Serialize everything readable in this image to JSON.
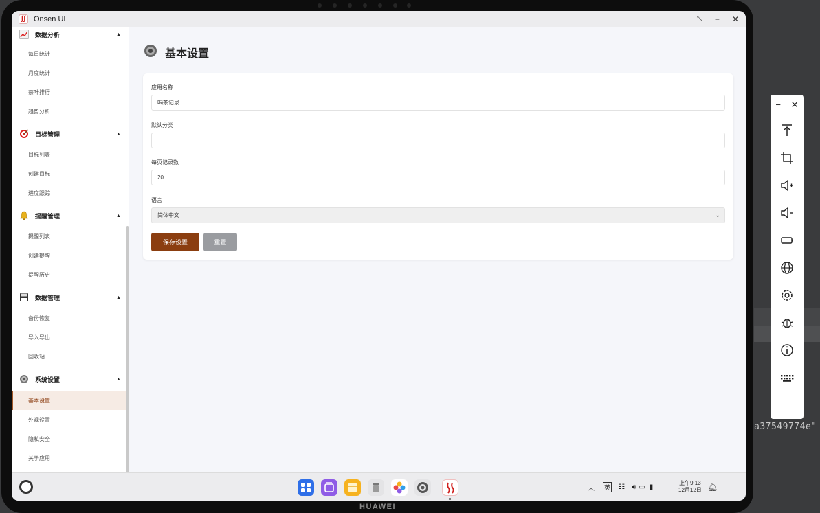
{
  "window": {
    "title": "Onsen UI",
    "logo_glyph": "ʃʃ"
  },
  "backdrop": {
    "text": "a37549774e\""
  },
  "device": {
    "brand": "HUAWEI"
  },
  "sidebar": {
    "groups": [
      {
        "label": "数据分析",
        "icon": "chart-icon",
        "items": [
          "每日统计",
          "月度统计",
          "茶叶排行",
          "趋势分析"
        ]
      },
      {
        "label": "目标管理",
        "icon": "target-icon",
        "items": [
          "目标列表",
          "创建目标",
          "进度跟踪"
        ]
      },
      {
        "label": "提醒管理",
        "icon": "bell-icon",
        "items": [
          "提醒列表",
          "创建提醒",
          "提醒历史"
        ]
      },
      {
        "label": "数据管理",
        "icon": "floppy-icon",
        "items": [
          "备份恢复",
          "导入导出",
          "回收站"
        ]
      },
      {
        "label": "系统设置",
        "icon": "gear-icon",
        "items": [
          "基本设置",
          "外观设置",
          "隐私安全",
          "关于应用"
        ]
      }
    ],
    "active_item": "基本设置"
  },
  "main": {
    "page_title": "基本设置",
    "form": {
      "app_name_label": "应用名称",
      "app_name_value": "喝茶记录",
      "default_category_label": "默认分类",
      "default_category_value": "",
      "per_page_label": "每页记录数",
      "per_page_value": "20",
      "language_label": "语言",
      "language_value": "简体中文",
      "save_label": "保存设置",
      "reset_label": "重置"
    }
  },
  "taskbar": {
    "clock_time": "上午9:13",
    "clock_date": "12月12日",
    "input_method": "英"
  },
  "colors": {
    "accent": "#8b3e10",
    "active_bg": "#f6ebe4",
    "reset": "#9a9ca0"
  }
}
